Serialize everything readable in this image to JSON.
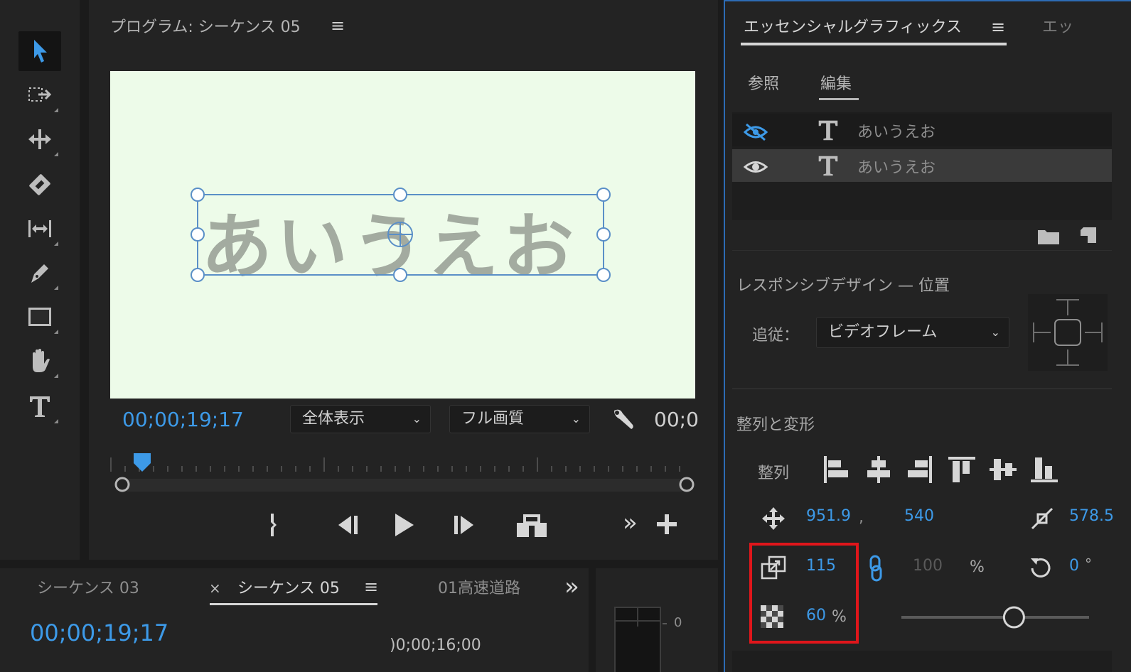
{
  "program": {
    "title": "プログラム: シーケンス 05",
    "menu_icon": "≡",
    "canvas_text": "あいうえお",
    "timecode": "00;00;19;17",
    "zoom_select": "全体表示",
    "quality_select": "フル画質",
    "duration_partial": "00;0"
  },
  "timeline": {
    "tabs": [
      {
        "label": "シーケンス 03"
      },
      {
        "label": "シーケンス 05",
        "active": true,
        "close": "×"
      },
      {
        "label": "01高速道路"
      }
    ],
    "more": "»",
    "timecode": "00;00;19;17",
    "ruler_label": ")0;00;16;00",
    "meter_labels": [
      "0",
      "-"
    ]
  },
  "essential_graphics": {
    "title": "エッセンシャルグラフィックス",
    "next_tab": "エッ",
    "tabs": [
      {
        "label": "参照"
      },
      {
        "label": "編集",
        "active": true
      }
    ],
    "layers": [
      {
        "name": "あいうえお",
        "visible": false
      },
      {
        "name": "あいうえお",
        "visible": true,
        "selected": true
      }
    ],
    "responsive": {
      "title": "レスポンシブデザイン — 位置",
      "follow_label": "追従：",
      "follow_value": "ビデオフレーム"
    },
    "align": {
      "title": "整列と変形",
      "align_label": "整列",
      "position_x": "951.9",
      "position_sep": ",",
      "position_y": "540",
      "anchor_x": "578.5",
      "scale": "115",
      "scale_h": "100",
      "scale_unit": "%",
      "rotation": "0",
      "rotation_unit": "°",
      "opacity": "60",
      "opacity_unit": "%",
      "opacity_fraction": 0.6
    }
  },
  "colors": {
    "accent": "#3d9ae8",
    "highlight": "#e0161b",
    "canvas": "#edfbe9"
  }
}
